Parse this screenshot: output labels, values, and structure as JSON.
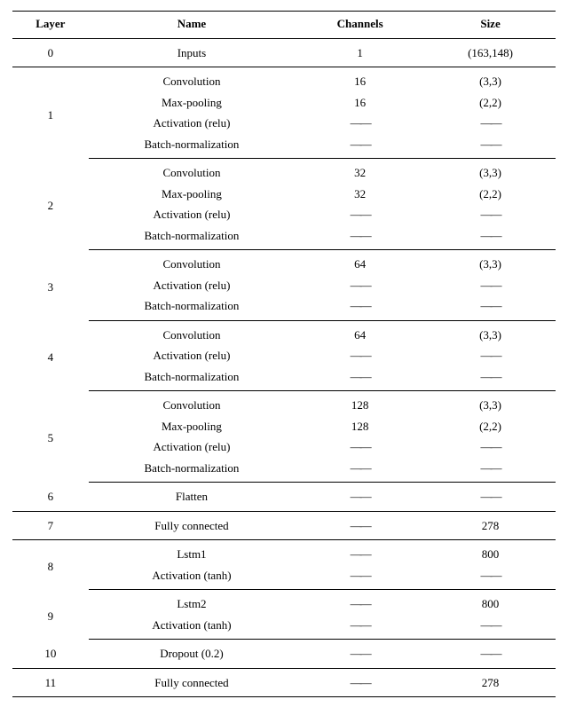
{
  "dash": "——",
  "headers": {
    "layer": "Layer",
    "name": "Name",
    "channels": "Channels",
    "size": "Size"
  },
  "rows": [
    {
      "layer": "0",
      "items": [
        {
          "name": "Inputs",
          "ch": "1",
          "sz": "(163,148)"
        }
      ]
    },
    {
      "layer": "1",
      "items": [
        {
          "name": "Convolution",
          "ch": "16",
          "sz": "(3,3)"
        },
        {
          "name": "Max-pooling",
          "ch": "16",
          "sz": "(2,2)"
        },
        {
          "name": "Activation (relu)",
          "ch": "@dash",
          "sz": "@dash"
        },
        {
          "name": "Batch-normalization",
          "ch": "@dash",
          "sz": "@dash"
        }
      ]
    },
    {
      "layer": "2",
      "items": [
        {
          "name": "Convolution",
          "ch": "32",
          "sz": "(3,3)"
        },
        {
          "name": "Max-pooling",
          "ch": "32",
          "sz": "(2,2)"
        },
        {
          "name": "Activation (relu)",
          "ch": "@dash",
          "sz": "@dash"
        },
        {
          "name": "Batch-normalization",
          "ch": "@dash",
          "sz": "@dash"
        }
      ]
    },
    {
      "layer": "3",
      "items": [
        {
          "name": "Convolution",
          "ch": "64",
          "sz": "(3,3)"
        },
        {
          "name": "Activation (relu)",
          "ch": "@dash",
          "sz": "@dash"
        },
        {
          "name": "Batch-normalization",
          "ch": "@dash",
          "sz": "@dash"
        }
      ]
    },
    {
      "layer": "4",
      "items": [
        {
          "name": "Convolution",
          "ch": "64",
          "sz": "(3,3)"
        },
        {
          "name": "Activation (relu)",
          "ch": "@dash",
          "sz": "@dash"
        },
        {
          "name": "Batch-normalization",
          "ch": "@dash",
          "sz": "@dash"
        }
      ]
    },
    {
      "layer": "5",
      "items": [
        {
          "name": "Convolution",
          "ch": "128",
          "sz": "(3,3)"
        },
        {
          "name": "Max-pooling",
          "ch": "128",
          "sz": "(2,2)"
        },
        {
          "name": "Activation (relu)",
          "ch": "@dash",
          "sz": "@dash"
        },
        {
          "name": "Batch-normalization",
          "ch": "@dash",
          "sz": "@dash"
        }
      ]
    },
    {
      "layer": "6",
      "items": [
        {
          "name": "Flatten",
          "ch": "@dash",
          "sz": "@dash"
        }
      ]
    },
    {
      "layer": "7",
      "items": [
        {
          "name": "Fully connected",
          "ch": "@dash",
          "sz": "278"
        }
      ]
    },
    {
      "layer": "8",
      "items": [
        {
          "name": "Lstm1",
          "ch": "@dash",
          "sz": "800"
        },
        {
          "name": "Activation (tanh)",
          "ch": "@dash",
          "sz": "@dash"
        }
      ]
    },
    {
      "layer": "9",
      "items": [
        {
          "name": "Lstm2",
          "ch": "@dash",
          "sz": "800"
        },
        {
          "name": "Activation (tanh)",
          "ch": "@dash",
          "sz": "@dash"
        }
      ]
    },
    {
      "layer": "10",
      "items": [
        {
          "name": "Dropout (0.2)",
          "ch": "@dash",
          "sz": "@dash"
        }
      ]
    },
    {
      "layer": "11",
      "items": [
        {
          "name": "Fully connected",
          "ch": "@dash",
          "sz": "278"
        }
      ]
    }
  ],
  "chart_data": {
    "type": "table",
    "title": "",
    "columns": [
      "Layer",
      "Name",
      "Channels",
      "Size"
    ],
    "rows": [
      [
        "0",
        "Inputs",
        "1",
        "(163,148)"
      ],
      [
        "1",
        "Convolution",
        "16",
        "(3,3)"
      ],
      [
        "1",
        "Max-pooling",
        "16",
        "(2,2)"
      ],
      [
        "1",
        "Activation (relu)",
        "—",
        "—"
      ],
      [
        "1",
        "Batch-normalization",
        "—",
        "—"
      ],
      [
        "2",
        "Convolution",
        "32",
        "(3,3)"
      ],
      [
        "2",
        "Max-pooling",
        "32",
        "(2,2)"
      ],
      [
        "2",
        "Activation (relu)",
        "—",
        "—"
      ],
      [
        "2",
        "Batch-normalization",
        "—",
        "—"
      ],
      [
        "3",
        "Convolution",
        "64",
        "(3,3)"
      ],
      [
        "3",
        "Activation (relu)",
        "—",
        "—"
      ],
      [
        "3",
        "Batch-normalization",
        "—",
        "—"
      ],
      [
        "4",
        "Convolution",
        "64",
        "(3,3)"
      ],
      [
        "4",
        "Activation (relu)",
        "—",
        "—"
      ],
      [
        "4",
        "Batch-normalization",
        "—",
        "—"
      ],
      [
        "5",
        "Convolution",
        "128",
        "(3,3)"
      ],
      [
        "5",
        "Max-pooling",
        "128",
        "(2,2)"
      ],
      [
        "5",
        "Activation (relu)",
        "—",
        "—"
      ],
      [
        "5",
        "Batch-normalization",
        "—",
        "—"
      ],
      [
        "6",
        "Flatten",
        "—",
        "—"
      ],
      [
        "7",
        "Fully connected",
        "—",
        "278"
      ],
      [
        "8",
        "Lstm1",
        "—",
        "800"
      ],
      [
        "8",
        "Activation (tanh)",
        "—",
        "—"
      ],
      [
        "9",
        "Lstm2",
        "—",
        "800"
      ],
      [
        "9",
        "Activation (tanh)",
        "—",
        "—"
      ],
      [
        "10",
        "Dropout (0.2)",
        "—",
        "—"
      ],
      [
        "11",
        "Fully connected",
        "—",
        "278"
      ]
    ]
  }
}
